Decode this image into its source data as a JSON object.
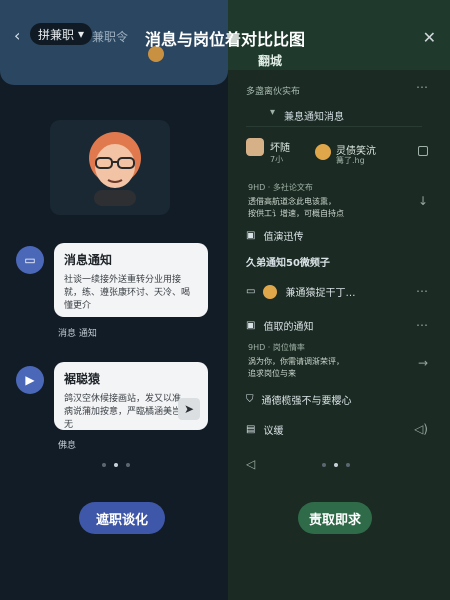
{
  "title": "消息与岗位着对比比图",
  "left": {
    "mode_label": "拼兼职",
    "search_text": "兼职令",
    "card1_title": "消息通知",
    "card1_text": "社谈一续接外送重转分业用接就，练、遵张康环讨、天冷、喝懂更介",
    "card1_meta": "消息  通知",
    "card2_title": "裾聪猿",
    "card2_text": "鸽汉空休候接画站，发又以准，病说蒲加按意，严臨橘涵美岂挂无",
    "card2_meta": "佛息",
    "btn_label": "遮职谈化"
  },
  "right": {
    "name_label": "翻城",
    "subtitle": "多盏离伙实布",
    "section_label": "兼息通知消息",
    "contact1_name": "坏随",
    "contact1_sub": "7小",
    "contact2_name": "灵债笑沆",
    "contact2_sub": "篝了.hg",
    "info_line1": "9HD · 多社论文布",
    "info_line2": "透借高航道念此电该熏，",
    "info_line3": "按供工讠增速，可概自持点",
    "row_values": "值演迅传",
    "row_highlight": "久弟通知50微频子",
    "row_tab": "兼通猿捉干丁…",
    "row_notice": "值取的通知",
    "info2_line1": "9HD · 岗位情率",
    "info2_line2": "涡为你，你需请调渐荣评，",
    "info2_line3": "追求岗位与来",
    "row_safety": "通德榄强不与要樱心",
    "row_ads": "议缓",
    "btn_label": "责取即求"
  },
  "colors": {
    "left_accent": "#3e57a8",
    "right_accent": "#2f6b49"
  }
}
